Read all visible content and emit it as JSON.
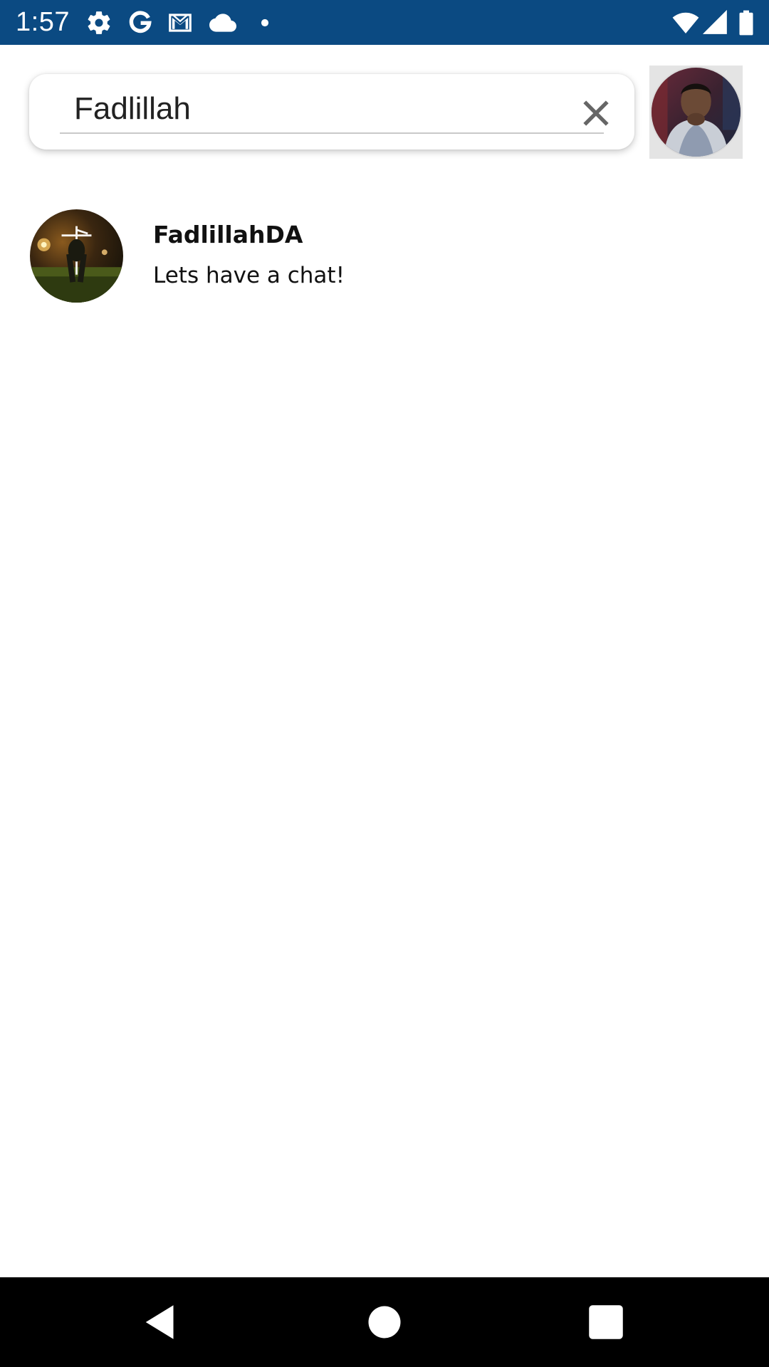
{
  "status_bar": {
    "time": "1:57",
    "left_icons": [
      "settings-icon",
      "google-icon",
      "gmail-icon",
      "cloud-icon",
      "dot-icon"
    ],
    "right_icons": [
      "wifi-icon",
      "cell-signal-icon",
      "battery-icon"
    ],
    "background_color": "#0b4a82"
  },
  "search": {
    "value": "Fadlillah",
    "clear_icon": "close-icon"
  },
  "profile": {
    "avatar_icon": "user-avatar"
  },
  "results": [
    {
      "name": "FadlillahDA",
      "message": "Lets have a chat!"
    }
  ],
  "nav_bar": {
    "buttons": [
      "back-icon",
      "home-icon",
      "recents-icon"
    ]
  }
}
